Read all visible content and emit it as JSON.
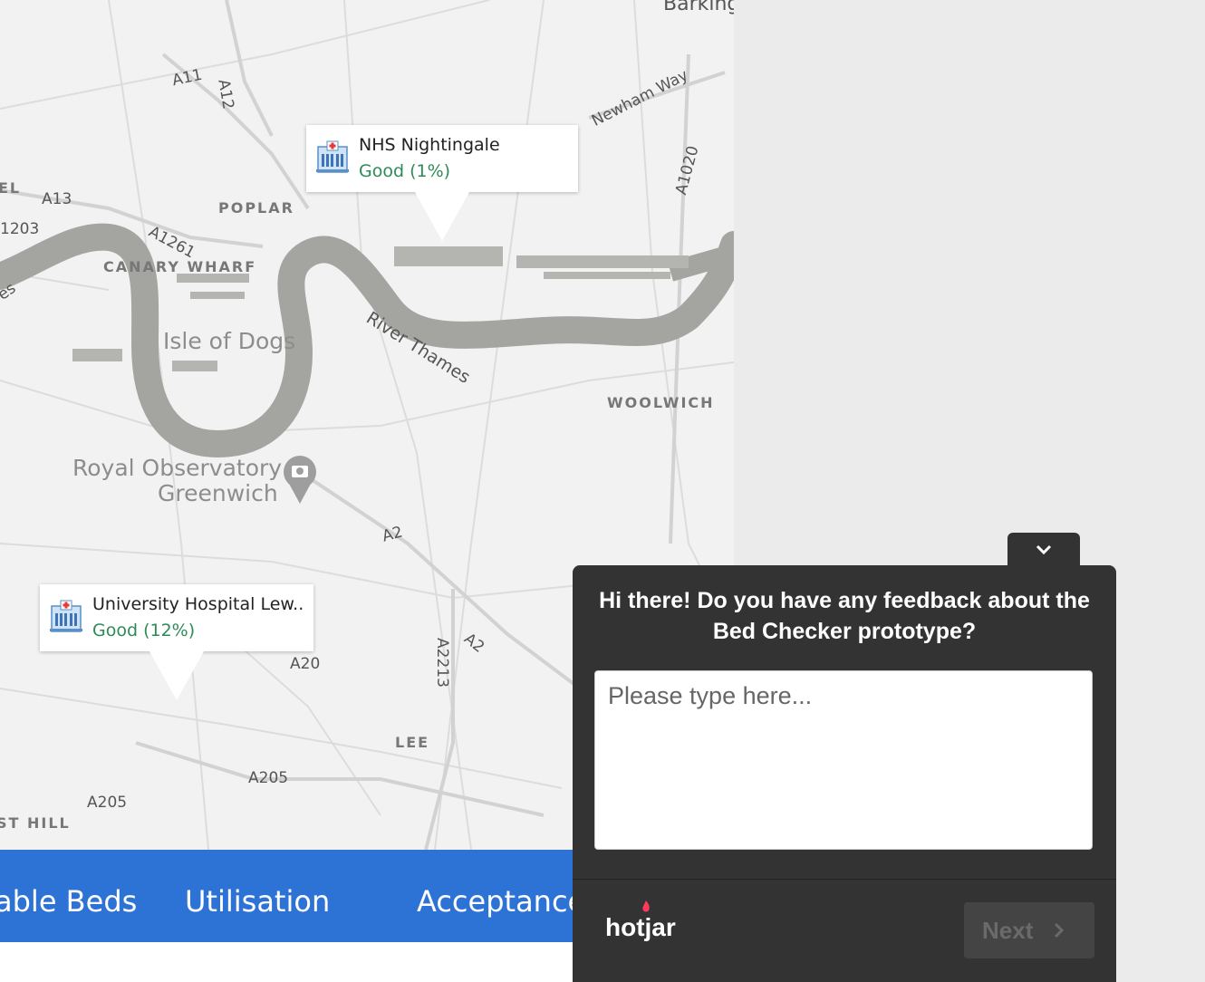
{
  "map": {
    "labels": {
      "barking": "Barking",
      "newham_way": "Newham Way",
      "a1020": "A1020",
      "a11": "A11",
      "a12": "A12",
      "el": "EL",
      "a13": "A13",
      "poplar": "POPLAR",
      "a1203": "1203",
      "a1261": "A1261",
      "canary_wharf": "CANARY WHARF",
      "es": "es",
      "isle_of_dogs": "Isle of Dogs",
      "river_thames": "River Thames",
      "woolwich": "WOOLWICH",
      "royal_observatory_1": "Royal Observatory",
      "royal_observatory_2": "Greenwich",
      "a2_top": "A2",
      "a2_right": "A2",
      "a2213": "A2213",
      "a20": "A20",
      "lee": "LEE",
      "a205_a": "A205",
      "a205_b": "A205",
      "hill": "ST HILL"
    },
    "markers": [
      {
        "name": "NHS Nightingale",
        "status": "Good (1%)",
        "icon": "hospital-icon"
      },
      {
        "name": "University Hospital Lew..",
        "status": "Good (12%)",
        "icon": "hospital-icon"
      }
    ]
  },
  "tabs": [
    "able Beds",
    "Utilisation",
    "Acceptance"
  ],
  "feedback": {
    "toggle_icon": "chevron-down-icon",
    "question": "Hi there! Do you have any feedback about the Bed Checker prototype?",
    "placeholder": "Please type here...",
    "brand": "hotjar",
    "next_label": "Next"
  },
  "colors": {
    "tab_bar": "#2d73d6",
    "status_good": "#2e8b57",
    "widget_bg": "#333333"
  }
}
